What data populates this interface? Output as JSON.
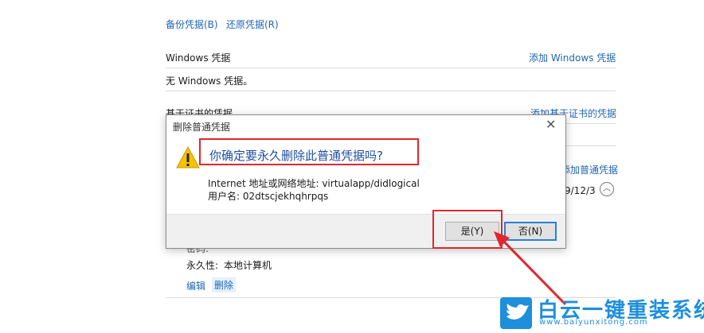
{
  "top_links": {
    "backup": "备份凭据(B)",
    "restore": "还原凭据(R)"
  },
  "windows_section": {
    "title": "Windows 凭据",
    "add_link": "添加 Windows 凭据",
    "empty_text": "无 Windows 凭据。"
  },
  "cert_section": {
    "title": "基于证书的凭据",
    "add_link": "添加基于证书的凭据"
  },
  "generic_section": {
    "add_link": "添加普通凭据",
    "date_partial": "9/12/3"
  },
  "entry": {
    "password_label": "密码:",
    "password_value": "••••••••",
    "persistence_label": "永久性:",
    "persistence_value": "本地计算机",
    "edit": "编辑",
    "delete": "删除"
  },
  "dialog": {
    "title": "删除普通凭据",
    "close_glyph": "✕",
    "question": "你确定要永久删除此普通凭据吗?",
    "address_line": "Internet 地址或网络地址: virtualapp/didlogical",
    "username_line": "用户名: 02dtscjekhqhrpqs",
    "yes_button": "是(Y)",
    "no_button": "否(N)"
  },
  "watermark": {
    "text": "白云一键重装系统",
    "url": "www.baiyunxitong.com"
  },
  "colors": {
    "link": "#2166b5",
    "annotation": "#e0272f",
    "question": "#1f4fa3",
    "logo": "#1e8fdc"
  }
}
